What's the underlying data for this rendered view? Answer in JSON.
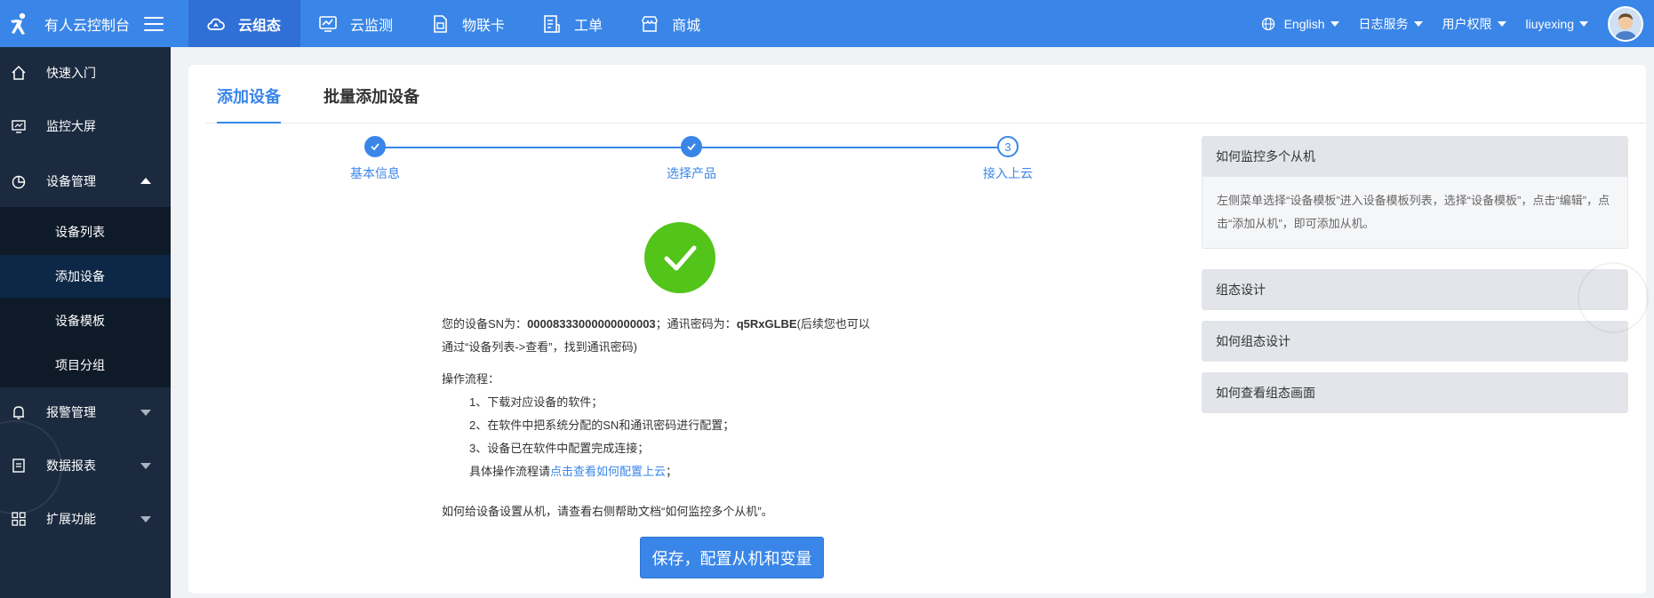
{
  "brand": {
    "name": "有人云控制台",
    "logo_icon": "person-running-icon",
    "menu_icon": "hamburger-icon"
  },
  "topnav": [
    {
      "label": "云组态",
      "icon": "cloud-icon",
      "active": true
    },
    {
      "label": "云监测",
      "icon": "monitor-chart-icon"
    },
    {
      "label": "物联卡",
      "icon": "sim-card-icon"
    },
    {
      "label": "工单",
      "icon": "document-icon"
    },
    {
      "label": "商城",
      "icon": "shop-icon"
    }
  ],
  "tools": {
    "language": "English",
    "logs": "日志服务",
    "permissions": "用户权限",
    "user": "liuyexing"
  },
  "sidebar": {
    "items": [
      {
        "label": "快速入门",
        "icon": "home-icon"
      },
      {
        "label": "监控大屏",
        "icon": "screen-icon"
      },
      {
        "label": "设备管理",
        "icon": "pie-icon"
      },
      {
        "label": "报警管理",
        "icon": "bell-icon"
      },
      {
        "label": "数据报表",
        "icon": "report-icon"
      },
      {
        "label": "扩展功能",
        "icon": "grid-icon"
      }
    ],
    "submenu": [
      {
        "label": "设备列表"
      },
      {
        "label": "添加设备",
        "active": true
      },
      {
        "label": "设备模板"
      },
      {
        "label": "项目分组"
      }
    ]
  },
  "tabs": [
    {
      "label": "添加设备",
      "active": true
    },
    {
      "label": "批量添加设备"
    }
  ],
  "steps": [
    {
      "label": "基本信息",
      "status": "done"
    },
    {
      "label": "选择产品",
      "status": "done"
    },
    {
      "label": "接入上云",
      "status": "current",
      "number": "3"
    }
  ],
  "result": {
    "sn_prefix": "您的设备SN为：",
    "sn": "00008333000000000003",
    "pwd_prefix": "；通讯密码为：",
    "pwd": "q5RxGLBE",
    "pwd_suffix": "(后续您也可以",
    "line2": "通过“设备列表->查看”，找到通讯密码)",
    "flow_title": "操作流程：",
    "flow_steps": [
      "1、下载对应设备的软件；",
      "2、在软件中把系统分配的SN和通讯密码进行配置；",
      "3、设备已在软件中配置完成连接；"
    ],
    "detail_prefix": "具体操作流程请",
    "detail_link": "点击查看如何配置上云",
    "detail_suffix": "；",
    "note": "如何给设备设置从机，请查看右侧帮助文档“如何监控多个从机”。",
    "save_button": "保存，配置从机和变量"
  },
  "help": [
    {
      "title": "如何监控多个从机",
      "body": "左侧菜单选择“设备模板”进入设备模板列表，选择“设备模板”，点击“编辑”，点击“添加从机”，即可添加从机。",
      "expanded": true
    },
    {
      "title": "组态设计"
    },
    {
      "title": "如何组态设计"
    },
    {
      "title": "如何查看组态画面"
    }
  ],
  "colors": {
    "primary": "#3a86e8",
    "sidebar": "#1b2a3f",
    "success": "#52c41a"
  }
}
